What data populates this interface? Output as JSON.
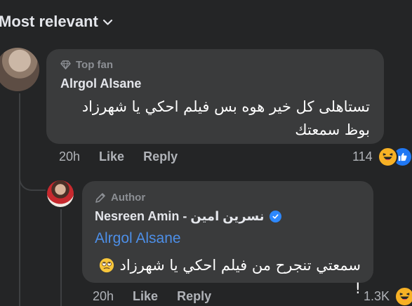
{
  "header": {
    "sort_label": "Most relevant",
    "sort_icon": "chevron-down-icon"
  },
  "comments": [
    {
      "badge": "Top fan",
      "badge_icon": "diamond-icon",
      "author": "Alrgol Alsane",
      "text": "تستاهلى كل خير هوه بس فيلم احكي يا شهرزاد بوظ سمعتك",
      "time": "20h",
      "like_label": "Like",
      "reply_label": "Reply",
      "reaction_count": "114",
      "reactions": [
        "laugh-reaction-icon",
        "like-reaction-icon"
      ]
    },
    {
      "badge": "Author",
      "badge_icon": "pen-icon",
      "author": "Nesreen Amin - نسرين امين",
      "verified_icon": "verified-icon",
      "mention": "Alrgol Alsane",
      "text_before_emoji": "سمعتي تنجرح من فيلم احكي يا شهرزاد",
      "emoji": "face-with-rolling-eyes",
      "text_after_emoji": "!",
      "time": "20h",
      "like_label": "Like",
      "reply_label": "Reply",
      "reaction_count": "1.3K",
      "reactions": [
        "laugh-reaction-icon"
      ]
    }
  ],
  "colors": {
    "background": "#242526",
    "bubble": "#3a3b3c",
    "primary_text": "#e4e6eb",
    "secondary_text": "#b0b3b8",
    "link": "#4d8fe8",
    "verified": "#2d88ff"
  }
}
